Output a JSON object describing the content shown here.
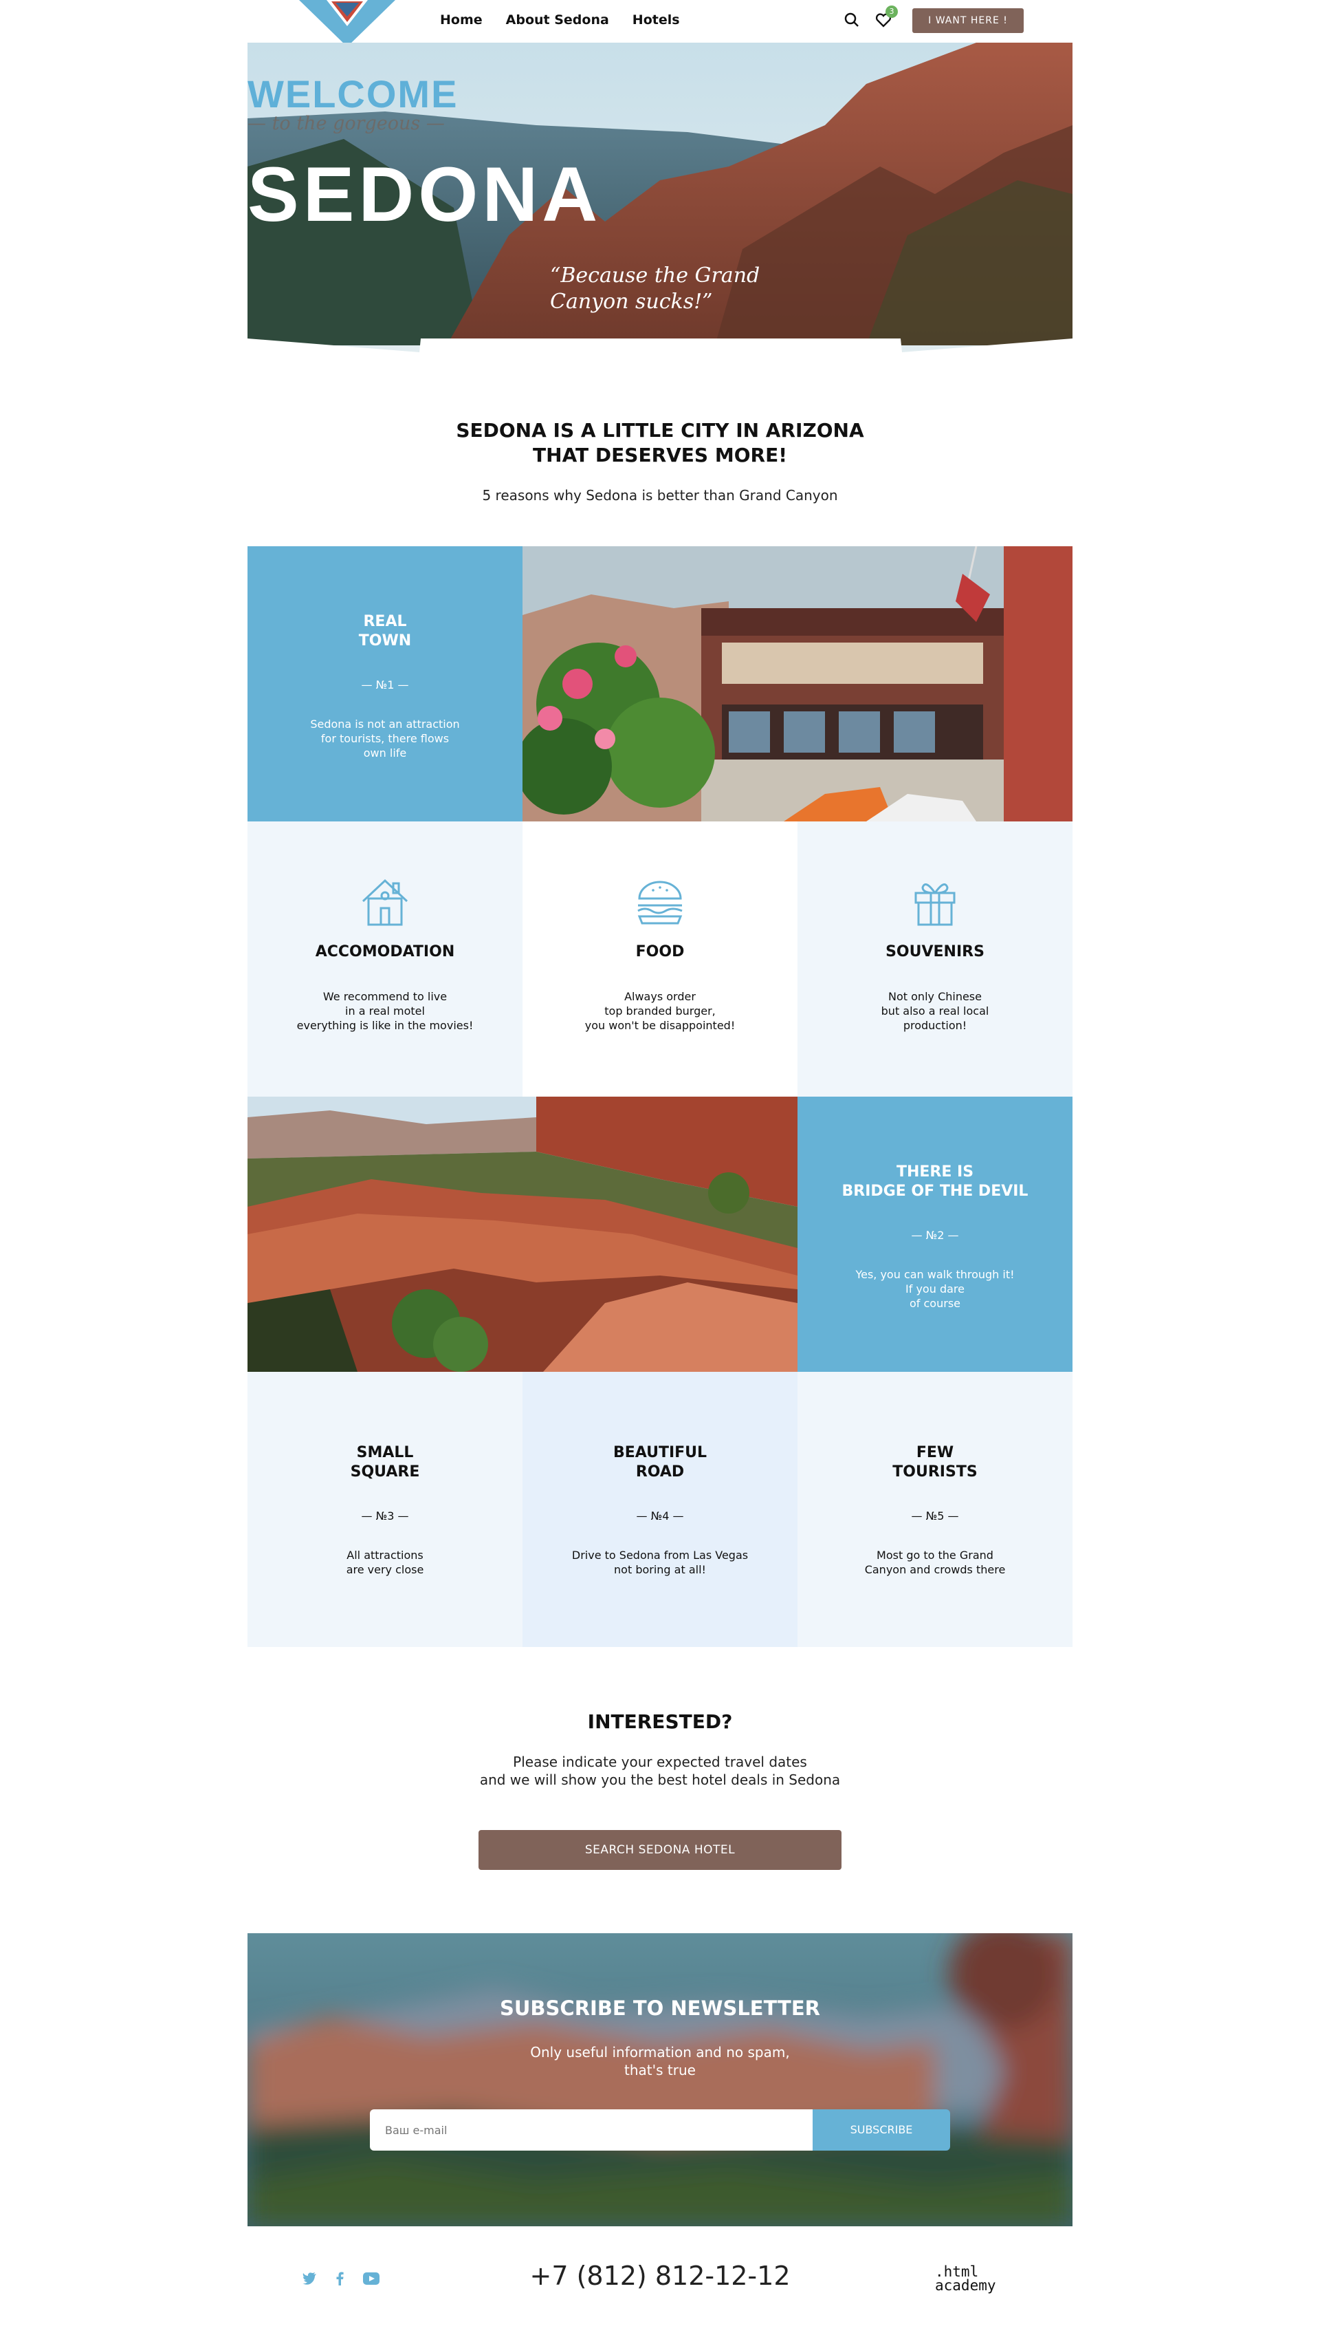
{
  "header": {
    "nav": [
      "Home",
      "About Sedona",
      "Hotels"
    ],
    "cart_count": "3",
    "cta_label": "I WANT HERE !"
  },
  "hero": {
    "welcome": "WELCOME",
    "subtitle": "— to the gorgeous —",
    "title": "SEDONA",
    "quote": "“Because the Grand Canyon sucks!”"
  },
  "intro": {
    "title_line1": "SEDONA IS A LITTLE CITY IN ARIZONA",
    "title_line2": "THAT DESERVES MORE!",
    "subtitle": "5 reasons why Sedona is better than Grand Canyon"
  },
  "reasons": {
    "real_town": {
      "title_line1": "REAL",
      "title_line2": "TOWN",
      "num": "— №1 —",
      "text_line1": "Sedona is not an attraction",
      "text_line2": "for tourists, there flows",
      "text_line3": "own life"
    },
    "bridge": {
      "title_line1": "THERE IS",
      "title_line2": "BRIDGE OF THE DEVIL",
      "num": "— №2 —",
      "text_line1": "Yes, you can walk through it!",
      "text_line2": "If you dare",
      "text_line3": "of course"
    },
    "square": {
      "title_line1": "SMALL",
      "title_line2": "SQUARE",
      "num": "— №3 —",
      "text_line1": "All attractions",
      "text_line2": "are very close"
    },
    "road": {
      "title_line1": "BEAUTIFUL",
      "title_line2": "ROAD",
      "num": "— №4 —",
      "text_line1": "Drive to Sedona from Las Vegas",
      "text_line2": "not boring at all!"
    },
    "tourists": {
      "title_line1": "FEW",
      "title_line2": "TOURISTS",
      "num": "— №5 —",
      "text_line1": "Most go to the Grand",
      "text_line2": "Canyon and crowds there"
    }
  },
  "features": {
    "accommodation": {
      "title": "ACCOMODATION",
      "text_line1": "We recommend to live",
      "text_line2": "in a real motel",
      "text_line3": "everything is like in the movies!"
    },
    "food": {
      "title": "FOOD",
      "text_line1": "Always order",
      "text_line2": "top branded burger,",
      "text_line3": "you won't be disappointed!"
    },
    "souvenirs": {
      "title": "SOUVENIRS",
      "text_line1": "Not only Chinese",
      "text_line2": "but also a real local",
      "text_line3": "production!"
    }
  },
  "interested": {
    "title": "INTERESTED?",
    "text_line1": "Please indicate your expected travel dates",
    "text_line2": "and we will show you the best hotel deals in Sedona",
    "button": "SEARCH SEDONA HOTEL"
  },
  "newsletter": {
    "title": "SUBSCRIBE TO NEWSLETTER",
    "text_line1": "Only useful information and no spam,",
    "text_line2": "that's true",
    "placeholder": "Ваш e-mail",
    "button": "SUBSCRIBE"
  },
  "footer": {
    "phone": "+7 (812) 812-12-12",
    "academy_line1": ".html",
    "academy_line2": "academy"
  },
  "colors": {
    "accent_blue": "#66b2d6",
    "brand_brown": "#806359",
    "light_bg": "#f0f6fb"
  }
}
